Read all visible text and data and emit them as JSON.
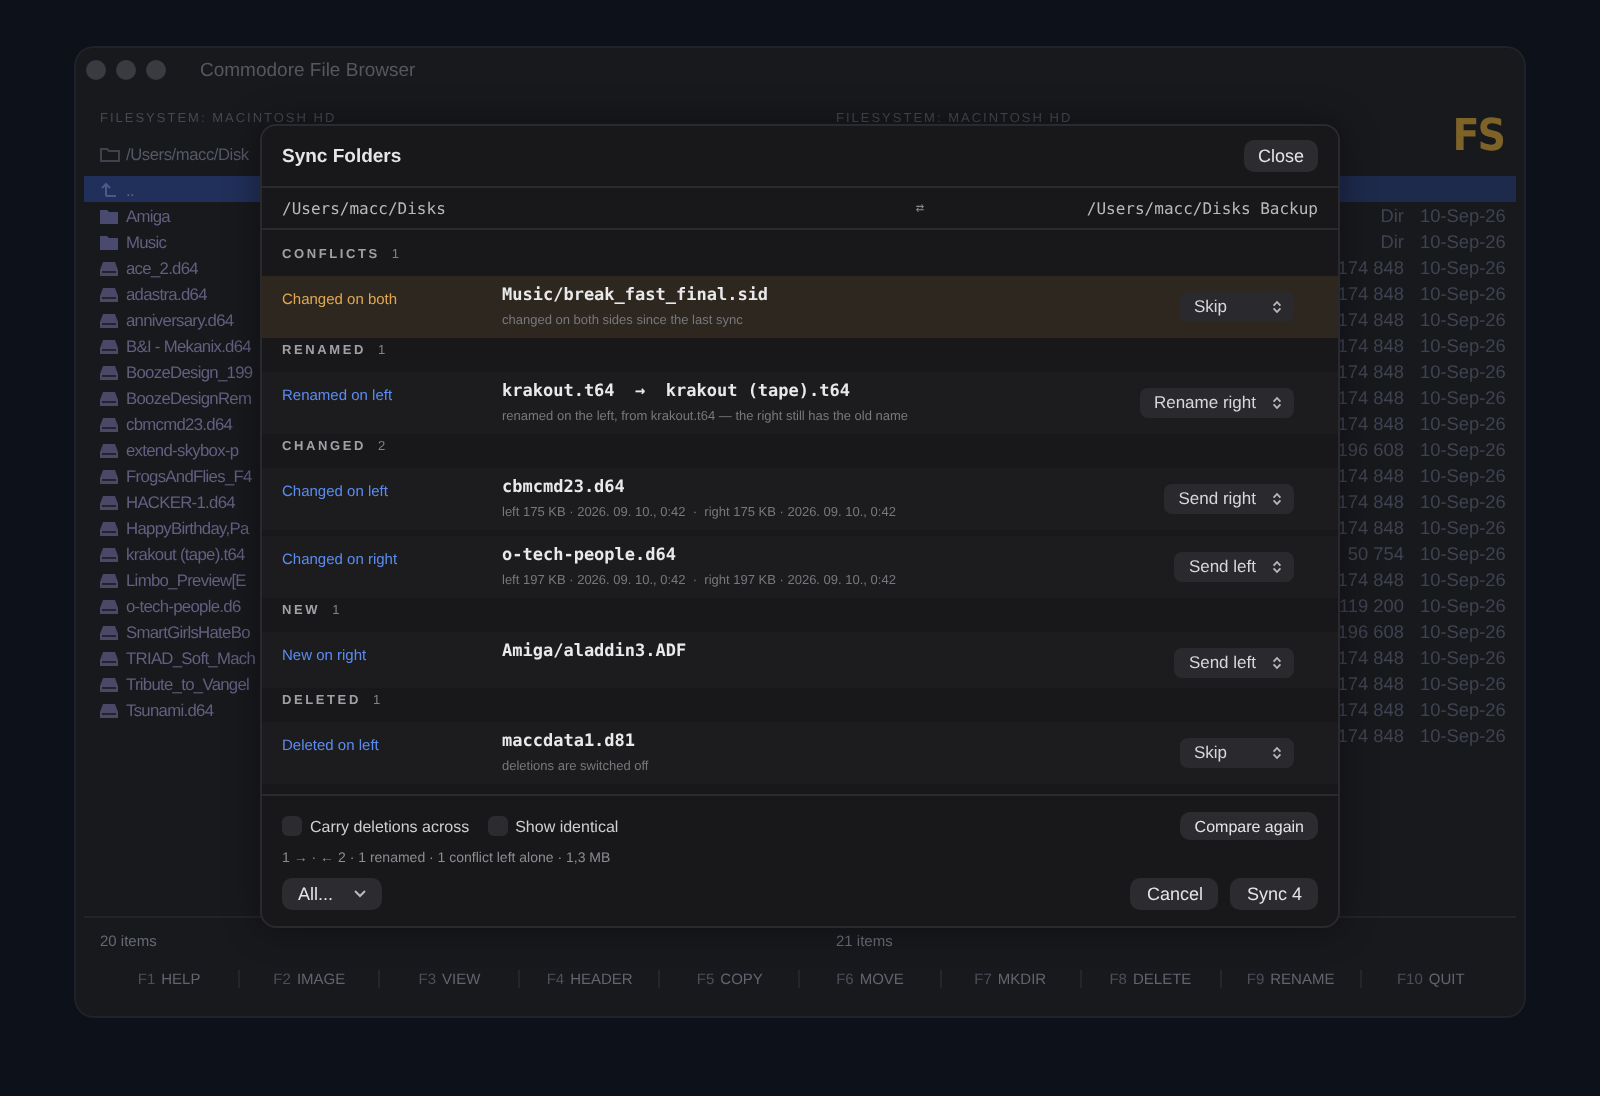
{
  "window": {
    "title": "Commodore File Browser"
  },
  "left_pane": {
    "header": "FILESYSTEM: MACINTOSH HD",
    "path": "/Users/macc/Disk",
    "status": "20 items",
    "items": [
      {
        "name": "..",
        "kind": "parent",
        "selected": true
      },
      {
        "name": "Amiga",
        "kind": "folder",
        "selected": false
      },
      {
        "name": "Music",
        "kind": "folder",
        "selected": false
      },
      {
        "name": "ace_2.d64",
        "kind": "disk",
        "selected": false
      },
      {
        "name": "adastra.d64",
        "kind": "disk",
        "selected": false
      },
      {
        "name": "anniversary.d64",
        "kind": "disk",
        "selected": false
      },
      {
        "name": "B&I - Mekanix.d64",
        "kind": "disk",
        "selected": false
      },
      {
        "name": "BoozeDesign_199",
        "kind": "disk",
        "selected": false
      },
      {
        "name": "BoozeDesignRem",
        "kind": "disk",
        "selected": false
      },
      {
        "name": "cbmcmd23.d64",
        "kind": "disk",
        "selected": false
      },
      {
        "name": "extend-skybox-p",
        "kind": "disk",
        "selected": false
      },
      {
        "name": "FrogsAndFlies_F4",
        "kind": "disk",
        "selected": false
      },
      {
        "name": "HACKER-1.d64",
        "kind": "disk",
        "selected": false
      },
      {
        "name": "HappyBirthday,Pa",
        "kind": "disk",
        "selected": false
      },
      {
        "name": "krakout (tape).t64",
        "kind": "disk",
        "selected": false
      },
      {
        "name": "Limbo_Preview[E",
        "kind": "disk",
        "selected": false
      },
      {
        "name": "o-tech-people.d6",
        "kind": "disk",
        "selected": false
      },
      {
        "name": "SmartGirlsHateBo",
        "kind": "disk",
        "selected": false
      },
      {
        "name": "TRIAD_Soft_Mach",
        "kind": "disk",
        "selected": false
      },
      {
        "name": "Tribute_to_Vangel",
        "kind": "disk",
        "selected": false
      },
      {
        "name": "Tsunami.d64",
        "kind": "disk",
        "selected": false
      }
    ]
  },
  "right_pane": {
    "header": "FILESYSTEM: MACINTOSH HD",
    "logo": "FS",
    "status": "21 items",
    "rows": [
      {
        "selected": true
      },
      {
        "size": "Dir",
        "date": "10-Sep-26",
        "selected": false
      },
      {
        "size": "Dir",
        "date": "10-Sep-26",
        "selected": false
      },
      {
        "size": "174 848",
        "date": "10-Sep-26",
        "selected": false
      },
      {
        "size": "174 848",
        "date": "10-Sep-26",
        "selected": false
      },
      {
        "size": "174 848",
        "date": "10-Sep-26",
        "selected": false
      },
      {
        "size": "174 848",
        "date": "10-Sep-26",
        "selected": false
      },
      {
        "size": "174 848",
        "date": "10-Sep-26",
        "selected": false
      },
      {
        "size": "174 848",
        "date": "10-Sep-26",
        "selected": false
      },
      {
        "size": "174 848",
        "date": "10-Sep-26",
        "selected": false
      },
      {
        "size": "196 608",
        "date": "10-Sep-26",
        "selected": false
      },
      {
        "size": "174 848",
        "date": "10-Sep-26",
        "selected": false
      },
      {
        "size": "174 848",
        "date": "10-Sep-26",
        "selected": false
      },
      {
        "size": "174 848",
        "date": "10-Sep-26",
        "selected": false
      },
      {
        "size": "50 754",
        "date": "10-Sep-26",
        "selected": false
      },
      {
        "size": "174 848",
        "date": "10-Sep-26",
        "selected": false
      },
      {
        "size": "119 200",
        "date": "10-Sep-26",
        "selected": false
      },
      {
        "size": "196 608",
        "date": "10-Sep-26",
        "selected": false
      },
      {
        "size": "174 848",
        "date": "10-Sep-26",
        "selected": false
      },
      {
        "size": "174 848",
        "date": "10-Sep-26",
        "selected": false
      },
      {
        "size": "174 848",
        "date": "10-Sep-26",
        "selected": false
      },
      {
        "size": "174 848",
        "date": "10-Sep-26",
        "selected": false
      }
    ]
  },
  "function_keys": [
    {
      "key": "F1",
      "label": "HELP"
    },
    {
      "key": "F2",
      "label": "IMAGE"
    },
    {
      "key": "F3",
      "label": "VIEW"
    },
    {
      "key": "F4",
      "label": "HEADER"
    },
    {
      "key": "F5",
      "label": "COPY"
    },
    {
      "key": "F6",
      "label": "MOVE"
    },
    {
      "key": "F7",
      "label": "MKDIR"
    },
    {
      "key": "F8",
      "label": "DELETE"
    },
    {
      "key": "F9",
      "label": "RENAME"
    },
    {
      "key": "F10",
      "label": "QUIT"
    }
  ],
  "sync_dialog": {
    "title": "Sync Folders",
    "close_button": "Close",
    "left_path": "/Users/macc/Disks",
    "swap_icon": "⇄",
    "right_path": "/Users/macc/Disks Backup",
    "sections": [
      {
        "title": "CONFLICTS",
        "count": "1",
        "rows": [
          {
            "kind": "conflict",
            "status": "Changed on both",
            "name": "Music/break_fast_final.sid",
            "detail": "changed on both sides since the last sync",
            "action": "Skip"
          }
        ]
      },
      {
        "title": "RENAMED",
        "count": "1",
        "rows": [
          {
            "kind": "change",
            "status": "Renamed on left",
            "name": "krakout.t64  →  krakout (tape).t64",
            "detail": "renamed on the left, from krakout.t64 — the right still has the old name",
            "action": "Rename right"
          }
        ]
      },
      {
        "title": "CHANGED",
        "count": "2",
        "rows": [
          {
            "kind": "change",
            "status": "Changed on left",
            "name": "cbmcmd23.d64",
            "detail": "left 175 KB · 2026. 09. 10., 0:42  ·  right 175 KB · 2026. 09. 10., 0:42",
            "action": "Send right"
          },
          {
            "kind": "change",
            "status": "Changed on right",
            "name": "o-tech-people.d64",
            "detail": "left 197 KB · 2026. 09. 10., 0:42  ·  right 197 KB · 2026. 09. 10., 0:42",
            "action": "Send left"
          }
        ]
      },
      {
        "title": "NEW",
        "count": "1",
        "rows": [
          {
            "kind": "change",
            "status": "New on right",
            "name": "Amiga/aladdin3.ADF",
            "action": "Send left"
          }
        ]
      },
      {
        "title": "DELETED",
        "count": "1",
        "rows": [
          {
            "kind": "change",
            "status": "Deleted on left",
            "name": "maccdata1.d81",
            "detail": "deletions are switched off",
            "action": "Skip"
          }
        ]
      }
    ],
    "options": [
      {
        "label": "Carry deletions across",
        "checked": false
      },
      {
        "label": "Show identical",
        "checked": false
      }
    ],
    "compare_button": "Compare again",
    "summary": "1 → · ← 2 · 1 renamed · 1 conflict left alone · 1,3 MB",
    "filter": "All...",
    "cancel_button": "Cancel",
    "sync_button": "Sync 4"
  }
}
